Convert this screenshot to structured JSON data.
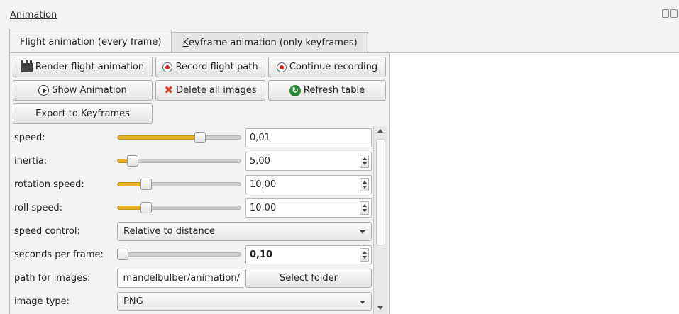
{
  "window": {
    "title": "Animation"
  },
  "tabs": [
    {
      "label": "Flight animation (every frame)"
    },
    {
      "label_u": "K",
      "label_rest": "eyframe animation (only keyframes)"
    }
  ],
  "toolbar": {
    "render": "Render flight animation",
    "record": "Record flight path",
    "continue": "Continue recording",
    "show": "Show Animation",
    "delete": "Delete all images",
    "refresh": "Refresh table",
    "export": "Export to Keyframes"
  },
  "params": {
    "speed": {
      "label": "speed:",
      "value": "0,01",
      "slider_fraction": 0.67
    },
    "inertia": {
      "label": "inertia:",
      "value": "5,00",
      "slider_fraction": 0.12
    },
    "rotation_speed": {
      "label": "rotation speed:",
      "value": "10,00",
      "slider_fraction": 0.23
    },
    "roll_speed": {
      "label": "roll speed:",
      "value": "10,00",
      "slider_fraction": 0.23
    },
    "speed_control": {
      "label": "speed control:",
      "value": "Relative to distance"
    },
    "seconds_per_frame": {
      "label": "seconds per frame:",
      "value": "0,10",
      "slider_fraction": 0.04
    },
    "path_for_images": {
      "label": "path for images:",
      "value": "mandelbulber/animation/",
      "button": "Select folder"
    },
    "image_type": {
      "label": "image type:",
      "value": "PNG"
    }
  }
}
